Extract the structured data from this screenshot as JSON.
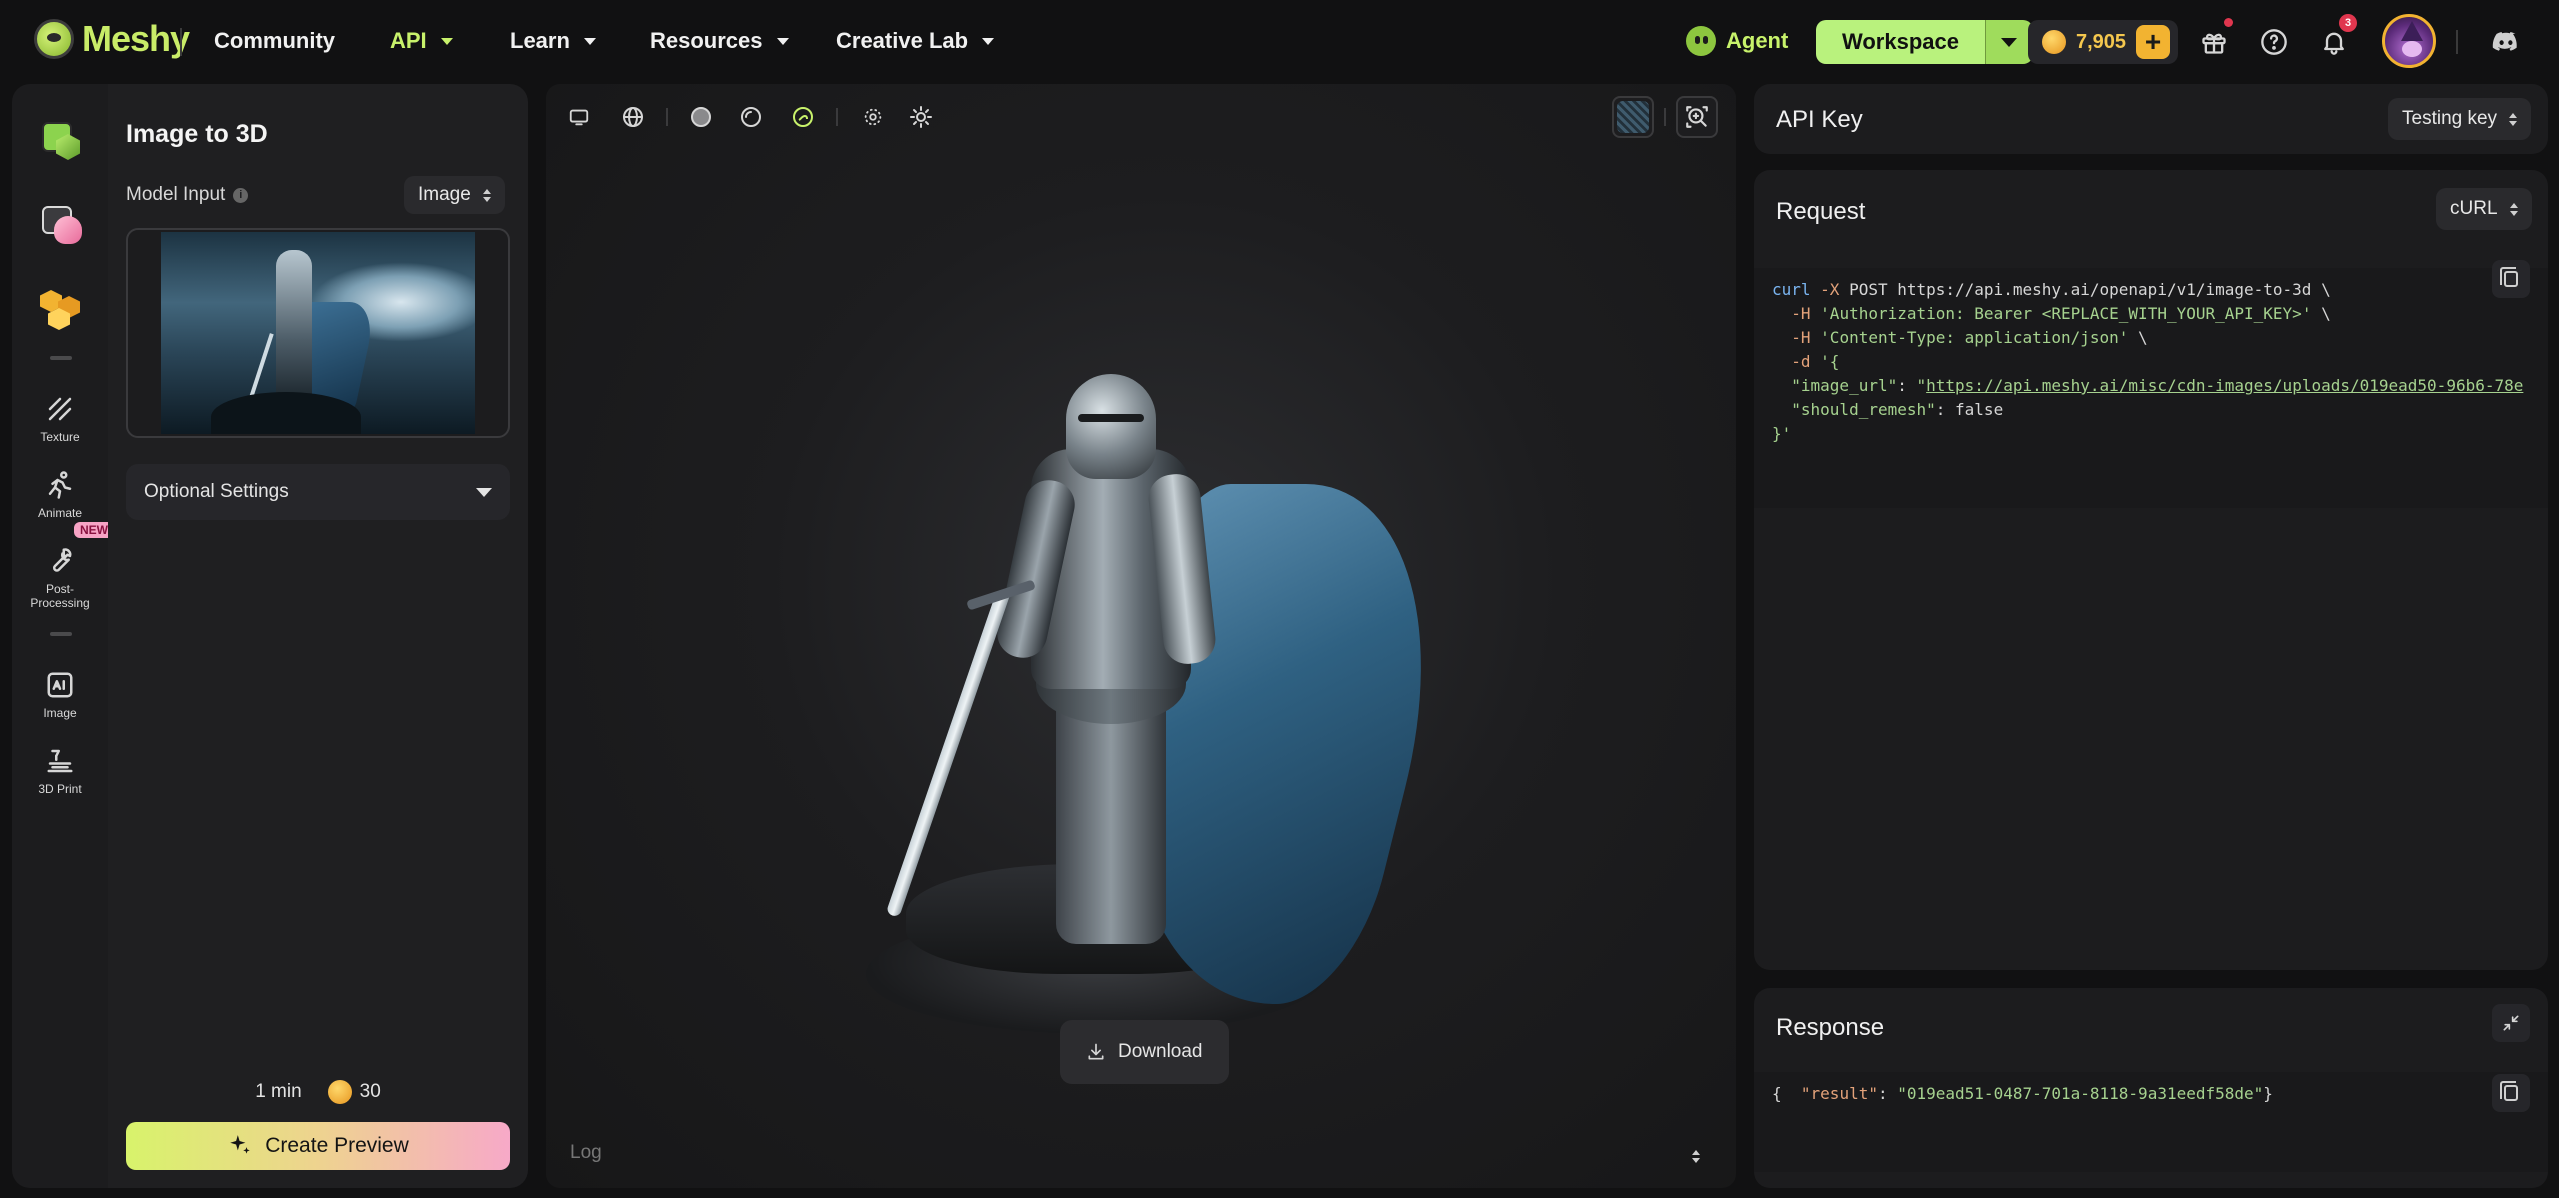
{
  "nav": {
    "brand": "Meshy",
    "items": [
      {
        "label": "Community"
      },
      {
        "label": "API"
      },
      {
        "label": "Learn"
      },
      {
        "label": "Resources"
      },
      {
        "label": "Creative Lab"
      }
    ],
    "agent_label": "Agent",
    "workspace_label": "Workspace",
    "credits": "7,905",
    "notification_count": "3",
    "icons": [
      "gift-icon",
      "help-icon",
      "bell-icon",
      "discord-icon"
    ]
  },
  "rail": {
    "items": [
      {
        "label": "",
        "icon": "text-to-3d-icon"
      },
      {
        "label": "",
        "icon": "image-to-3d-icon"
      },
      {
        "label": "",
        "icon": "multi-image-to-3d-icon"
      },
      {
        "label": "Texture",
        "icon": "texture-icon"
      },
      {
        "label": "Animate",
        "icon": "animate-icon"
      },
      {
        "label": "Post-\nProcessing",
        "icon": "wrench-icon",
        "badge": "NEW"
      },
      {
        "label": "Image",
        "icon": "ai-image-icon"
      },
      {
        "label": "3D Print",
        "icon": "3d-print-icon"
      }
    ]
  },
  "panel": {
    "title": "Image to 3D",
    "model_input_label": "Model Input",
    "input_type": "Image",
    "optional_settings": "Optional Settings",
    "time_estimate": "1 min",
    "cost": "30",
    "create_button": "Create Preview"
  },
  "viewport": {
    "download_label": "Download",
    "log_label": "Log",
    "toolbar_icons": [
      "monitor-icon",
      "globe-icon",
      "solid-shading-icon",
      "clay-shading-icon",
      "textured-shading-icon",
      "light-low-icon",
      "light-high-icon"
    ],
    "corner_icons": [
      "texture-preview-icon",
      "zoom-fit-icon"
    ]
  },
  "api": {
    "api_key_title": "API Key",
    "api_key_option": "Testing key",
    "request_title": "Request",
    "request_lang": "cURL",
    "request_lines": [
      {
        "parts": [
          {
            "t": "curl",
            "c": "kw"
          },
          {
            "t": " -X ",
            "c": "flag"
          },
          {
            "t": "POST https://api.meshy.ai/openapi/v1/image-to-3d \\",
            "c": "plain"
          }
        ]
      },
      {
        "parts": [
          {
            "t": "  -H ",
            "c": "flag"
          },
          {
            "t": "'Authorization: Bearer <REPLACE_WITH_YOUR_API_KEY>'",
            "c": "str"
          },
          {
            "t": " \\",
            "c": "plain"
          }
        ]
      },
      {
        "parts": [
          {
            "t": "  -H ",
            "c": "flag"
          },
          {
            "t": "'Content-Type: application/json'",
            "c": "str"
          },
          {
            "t": " \\",
            "c": "plain"
          }
        ]
      },
      {
        "parts": [
          {
            "t": "  -d ",
            "c": "flag"
          },
          {
            "t": "'{",
            "c": "str"
          }
        ]
      },
      {
        "parts": [
          {
            "t": "  \"image_url\"",
            "c": "key"
          },
          {
            "t": ": ",
            "c": "plain"
          },
          {
            "t": "\"",
            "c": "str"
          },
          {
            "t": "https://api.meshy.ai/misc/cdn-images/uploads/019ead50-96b6-78e",
            "c": "url"
          }
        ]
      },
      {
        "parts": [
          {
            "t": "  \"should_remesh\"",
            "c": "key"
          },
          {
            "t": ": false",
            "c": "plain"
          }
        ]
      },
      {
        "parts": [
          {
            "t": "}'",
            "c": "str"
          }
        ]
      }
    ],
    "response_title": "Response",
    "response_lines": [
      {
        "parts": [
          {
            "t": "{",
            "c": "plain"
          }
        ]
      },
      {
        "parts": [
          {
            "t": "  \"result\"",
            "c": "flag"
          },
          {
            "t": ": ",
            "c": "plain"
          },
          {
            "t": "\"019ead51-0487-701a-8118-9a31eedf58de\"",
            "c": "str"
          }
        ]
      },
      {
        "parts": [
          {
            "t": "}",
            "c": "plain"
          }
        ]
      }
    ]
  },
  "colors": {
    "accent_green": "#c8f26b",
    "credit_gold": "#f2b331",
    "badge_red": "#e0364e",
    "cape_blue": "#2f6182"
  }
}
